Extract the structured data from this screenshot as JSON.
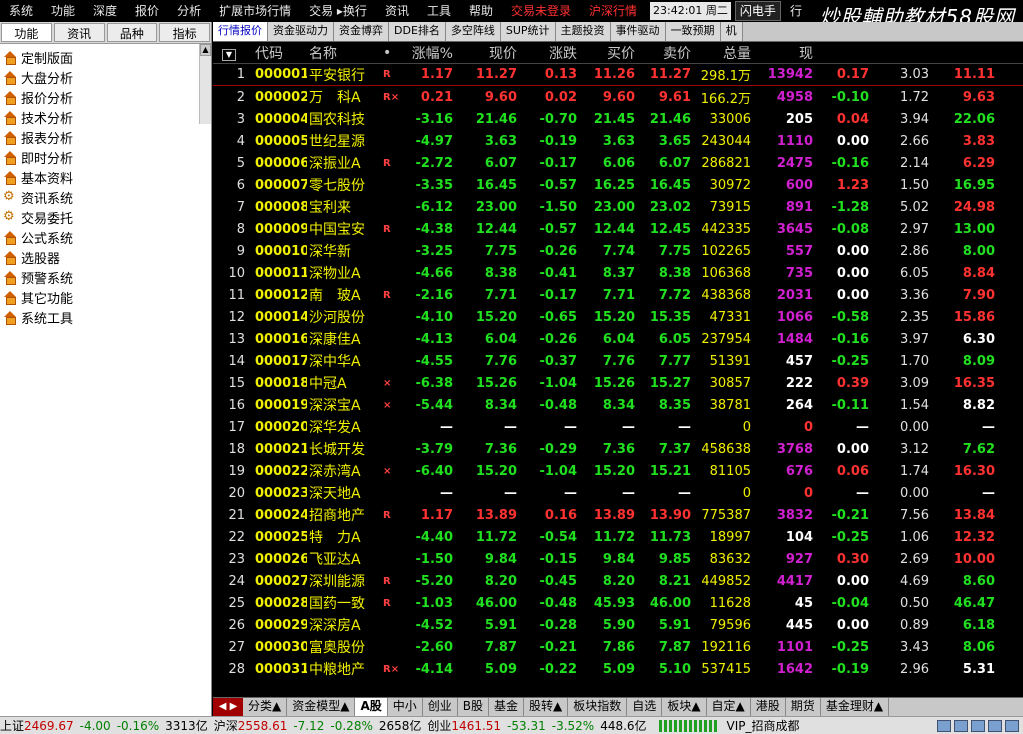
{
  "menubar": {
    "items": [
      "系统",
      "功能",
      "深度",
      "报价",
      "分析",
      "扩展市场行情",
      "交易 ▸换行",
      "资讯",
      "工具",
      "帮助"
    ],
    "red_items": [
      "交易未登录",
      "沪深行情"
    ],
    "time": "23:42:01",
    "weekday": "周二",
    "flash_label": "闪电手",
    "more_label": "行",
    "watermark": "炒股輔助教材58股网",
    "watermark_url": "www.58Gu.com"
  },
  "lefttabs": [
    "功能",
    "资讯",
    "品种",
    "指标"
  ],
  "nav": [
    {
      "label": "定制版面",
      "icon": "house-icon"
    },
    {
      "label": "大盘分析",
      "icon": "house-icon"
    },
    {
      "label": "报价分析",
      "icon": "house-icon"
    },
    {
      "label": "技术分析",
      "icon": "house-icon"
    },
    {
      "label": "报表分析",
      "icon": "house-icon"
    },
    {
      "label": "即时分析",
      "icon": "house-icon"
    },
    {
      "label": "基本资料",
      "icon": "house-icon"
    },
    {
      "label": "资讯系统",
      "icon": "gears-icon"
    },
    {
      "label": "交易委托",
      "icon": "gears-icon"
    },
    {
      "label": "公式系统",
      "icon": "house-icon"
    },
    {
      "label": "选股器",
      "icon": "house-icon"
    },
    {
      "label": "预警系统",
      "icon": "house-icon"
    },
    {
      "label": "其它功能",
      "icon": "house-icon"
    },
    {
      "label": "系统工具",
      "icon": "house-icon"
    }
  ],
  "toptabs": [
    "行情报价",
    "资金驱动力",
    "资金博弈",
    "DDE排名",
    "多空阵线",
    "SUP统计",
    "主题投资",
    "事件驱动",
    "一致预期",
    "机"
  ],
  "columns": [
    "代码",
    "名称",
    "•",
    "涨幅%",
    "现价",
    "涨跌",
    "买价",
    "卖价",
    "总量",
    "现",
    "",
    "",
    ""
  ],
  "rows": [
    {
      "idx": "1",
      "code": "000001",
      "name": "平安银行",
      "flag": "R",
      "chg": "1.17",
      "price": "11.27",
      "delta": "0.13",
      "buy": "11.26",
      "sell": "11.27",
      "vol": "298.1万",
      "now": "13942",
      "spd": "0.17",
      "turn": "3.03",
      "pe": "11.11",
      "dir": "up",
      "spd_dir": "up",
      "pe_dir": "up"
    },
    {
      "idx": "2",
      "code": "000002",
      "name": "万　科A",
      "flag": "R×",
      "chg": "0.21",
      "price": "9.60",
      "delta": "0.02",
      "buy": "9.60",
      "sell": "9.61",
      "vol": "166.2万",
      "now": "4958",
      "spd": "-0.10",
      "turn": "1.72",
      "pe": "9.63",
      "dir": "up",
      "spd_dir": "dn",
      "pe_dir": "up"
    },
    {
      "idx": "3",
      "code": "000004",
      "name": "国农科技",
      "flag": "",
      "chg": "-3.16",
      "price": "21.46",
      "delta": "-0.70",
      "buy": "21.45",
      "sell": "21.46",
      "vol": "33006",
      "now": "205",
      "spd": "0.04",
      "turn": "3.94",
      "pe": "22.06",
      "dir": "dn",
      "spd_dir": "up",
      "pe_dir": "dn",
      "now_white": true
    },
    {
      "idx": "4",
      "code": "000005",
      "name": "世纪星源",
      "flag": "",
      "chg": "-4.97",
      "price": "3.63",
      "delta": "-0.19",
      "buy": "3.63",
      "sell": "3.65",
      "vol": "243044",
      "now": "1110",
      "spd": "0.00",
      "turn": "2.66",
      "pe": "3.83",
      "dir": "dn",
      "spd_dir": "eq",
      "pe_dir": "up"
    },
    {
      "idx": "5",
      "code": "000006",
      "name": "深振业A",
      "flag": "R",
      "chg": "-2.72",
      "price": "6.07",
      "delta": "-0.17",
      "buy": "6.06",
      "sell": "6.07",
      "vol": "286821",
      "now": "2475",
      "spd": "-0.16",
      "turn": "2.14",
      "pe": "6.29",
      "dir": "dn",
      "spd_dir": "dn",
      "pe_dir": "up"
    },
    {
      "idx": "6",
      "code": "000007",
      "name": "零七股份",
      "flag": "",
      "chg": "-3.35",
      "price": "16.45",
      "delta": "-0.57",
      "buy": "16.25",
      "sell": "16.45",
      "vol": "30972",
      "now": "600",
      "spd": "1.23",
      "turn": "1.50",
      "pe": "16.95",
      "dir": "dn",
      "spd_dir": "up",
      "pe_dir": "dn"
    },
    {
      "idx": "7",
      "code": "000008",
      "name": "宝利来",
      "flag": "",
      "chg": "-6.12",
      "price": "23.00",
      "delta": "-1.50",
      "buy": "23.00",
      "sell": "23.02",
      "vol": "73915",
      "now": "891",
      "spd": "-1.28",
      "turn": "5.02",
      "pe": "24.98",
      "dir": "dn",
      "spd_dir": "dn",
      "pe_dir": "up"
    },
    {
      "idx": "8",
      "code": "000009",
      "name": "中国宝安",
      "flag": "R",
      "chg": "-4.38",
      "price": "12.44",
      "delta": "-0.57",
      "buy": "12.44",
      "sell": "12.45",
      "vol": "442335",
      "now": "3645",
      "spd": "-0.08",
      "turn": "2.97",
      "pe": "13.00",
      "dir": "dn",
      "spd_dir": "dn",
      "pe_dir": "dn"
    },
    {
      "idx": "9",
      "code": "000010",
      "name": "深华新",
      "flag": "",
      "chg": "-3.25",
      "price": "7.75",
      "delta": "-0.26",
      "buy": "7.74",
      "sell": "7.75",
      "vol": "102265",
      "now": "557",
      "spd": "0.00",
      "turn": "2.86",
      "pe": "8.00",
      "dir": "dn",
      "spd_dir": "eq",
      "pe_dir": "dn"
    },
    {
      "idx": "10",
      "code": "000011",
      "name": "深物业A",
      "flag": "",
      "chg": "-4.66",
      "price": "8.38",
      "delta": "-0.41",
      "buy": "8.37",
      "sell": "8.38",
      "vol": "106368",
      "now": "735",
      "spd": "0.00",
      "turn": "6.05",
      "pe": "8.84",
      "dir": "dn",
      "spd_dir": "eq",
      "pe_dir": "up"
    },
    {
      "idx": "11",
      "code": "000012",
      "name": "南　玻A",
      "flag": "R",
      "chg": "-2.16",
      "price": "7.71",
      "delta": "-0.17",
      "buy": "7.71",
      "sell": "7.72",
      "vol": "438368",
      "now": "2031",
      "spd": "0.00",
      "turn": "3.36",
      "pe": "7.90",
      "dir": "dn",
      "spd_dir": "eq",
      "pe_dir": "up"
    },
    {
      "idx": "12",
      "code": "000014",
      "name": "沙河股份",
      "flag": "",
      "chg": "-4.10",
      "price": "15.20",
      "delta": "-0.65",
      "buy": "15.20",
      "sell": "15.35",
      "vol": "47331",
      "now": "1066",
      "spd": "-0.58",
      "turn": "2.35",
      "pe": "15.86",
      "dir": "dn",
      "spd_dir": "dn",
      "pe_dir": "up"
    },
    {
      "idx": "13",
      "code": "000016",
      "name": "深康佳A",
      "flag": "",
      "chg": "-4.13",
      "price": "6.04",
      "delta": "-0.26",
      "buy": "6.04",
      "sell": "6.05",
      "vol": "237954",
      "now": "1484",
      "spd": "-0.16",
      "turn": "3.97",
      "pe": "6.30",
      "dir": "dn",
      "spd_dir": "dn",
      "pe_dir": "eq"
    },
    {
      "idx": "14",
      "code": "000017",
      "name": "深中华A",
      "flag": "",
      "chg": "-4.55",
      "price": "7.76",
      "delta": "-0.37",
      "buy": "7.76",
      "sell": "7.77",
      "vol": "51391",
      "now": "457",
      "spd": "-0.25",
      "turn": "1.70",
      "pe": "8.09",
      "dir": "dn",
      "spd_dir": "dn",
      "pe_dir": "dn",
      "now_white": true
    },
    {
      "idx": "15",
      "code": "000018",
      "name": "中冠A",
      "flag": "×",
      "chg": "-6.38",
      "price": "15.26",
      "delta": "-1.04",
      "buy": "15.26",
      "sell": "15.27",
      "vol": "30857",
      "now": "222",
      "spd": "0.39",
      "turn": "3.09",
      "pe": "16.35",
      "dir": "dn",
      "spd_dir": "up",
      "pe_dir": "up",
      "now_white": true
    },
    {
      "idx": "16",
      "code": "000019",
      "name": "深深宝A",
      "flag": "×",
      "chg": "-5.44",
      "price": "8.34",
      "delta": "-0.48",
      "buy": "8.34",
      "sell": "8.35",
      "vol": "38781",
      "now": "264",
      "spd": "-0.11",
      "turn": "1.54",
      "pe": "8.82",
      "dir": "dn",
      "spd_dir": "dn",
      "pe_dir": "eq",
      "now_white": true
    },
    {
      "idx": "17",
      "code": "000020",
      "name": "深华发A",
      "flag": "",
      "chg": "—",
      "price": "—",
      "delta": "—",
      "buy": "—",
      "sell": "—",
      "vol": "0",
      "now": "0",
      "spd": "—",
      "turn": "0.00",
      "pe": "—",
      "dir": "eq",
      "spd_dir": "eq",
      "pe_dir": "eq",
      "now_red": true
    },
    {
      "idx": "18",
      "code": "000021",
      "name": "长城开发",
      "flag": "",
      "chg": "-3.79",
      "price": "7.36",
      "delta": "-0.29",
      "buy": "7.36",
      "sell": "7.37",
      "vol": "458638",
      "now": "3768",
      "spd": "0.00",
      "turn": "3.12",
      "pe": "7.62",
      "dir": "dn",
      "spd_dir": "eq",
      "pe_dir": "dn"
    },
    {
      "idx": "19",
      "code": "000022",
      "name": "深赤湾A",
      "flag": "×",
      "chg": "-6.40",
      "price": "15.20",
      "delta": "-1.04",
      "buy": "15.20",
      "sell": "15.21",
      "vol": "81105",
      "now": "676",
      "spd": "0.06",
      "turn": "1.74",
      "pe": "16.30",
      "dir": "dn",
      "spd_dir": "up",
      "pe_dir": "up"
    },
    {
      "idx": "20",
      "code": "000023",
      "name": "深天地A",
      "flag": "",
      "chg": "—",
      "price": "—",
      "delta": "—",
      "buy": "—",
      "sell": "—",
      "vol": "0",
      "now": "0",
      "spd": "—",
      "turn": "0.00",
      "pe": "—",
      "dir": "eq",
      "spd_dir": "eq",
      "pe_dir": "eq",
      "now_red": true
    },
    {
      "idx": "21",
      "code": "000024",
      "name": "招商地产",
      "flag": "R",
      "chg": "1.17",
      "price": "13.89",
      "delta": "0.16",
      "buy": "13.89",
      "sell": "13.90",
      "vol": "775387",
      "now": "3832",
      "spd": "-0.21",
      "turn": "7.56",
      "pe": "13.84",
      "dir": "up",
      "spd_dir": "dn",
      "pe_dir": "up"
    },
    {
      "idx": "22",
      "code": "000025",
      "name": "特　力A",
      "flag": "",
      "chg": "-4.40",
      "price": "11.72",
      "delta": "-0.54",
      "buy": "11.72",
      "sell": "11.73",
      "vol": "18997",
      "now": "104",
      "spd": "-0.25",
      "turn": "1.06",
      "pe": "12.32",
      "dir": "dn",
      "spd_dir": "dn",
      "pe_dir": "up",
      "now_white": true
    },
    {
      "idx": "23",
      "code": "000026",
      "name": "飞亚达A",
      "flag": "",
      "chg": "-1.50",
      "price": "9.84",
      "delta": "-0.15",
      "buy": "9.84",
      "sell": "9.85",
      "vol": "83632",
      "now": "927",
      "spd": "0.30",
      "turn": "2.69",
      "pe": "10.00",
      "dir": "dn",
      "spd_dir": "up",
      "pe_dir": "up"
    },
    {
      "idx": "24",
      "code": "000027",
      "name": "深圳能源",
      "flag": "R",
      "chg": "-5.20",
      "price": "8.20",
      "delta": "-0.45",
      "buy": "8.20",
      "sell": "8.21",
      "vol": "449852",
      "now": "4417",
      "spd": "0.00",
      "turn": "4.69",
      "pe": "8.60",
      "dir": "dn",
      "spd_dir": "eq",
      "pe_dir": "dn"
    },
    {
      "idx": "25",
      "code": "000028",
      "name": "国药一致",
      "flag": "R",
      "chg": "-1.03",
      "price": "46.00",
      "delta": "-0.48",
      "buy": "45.93",
      "sell": "46.00",
      "vol": "11628",
      "now": "45",
      "spd": "-0.04",
      "turn": "0.50",
      "pe": "46.47",
      "dir": "dn",
      "spd_dir": "dn",
      "pe_dir": "dn",
      "now_white": true
    },
    {
      "idx": "26",
      "code": "000029",
      "name": "深深房A",
      "flag": "",
      "chg": "-4.52",
      "price": "5.91",
      "delta": "-0.28",
      "buy": "5.90",
      "sell": "5.91",
      "vol": "79596",
      "now": "445",
      "spd": "0.00",
      "turn": "0.89",
      "pe": "6.18",
      "dir": "dn",
      "spd_dir": "eq",
      "pe_dir": "dn",
      "now_white": true
    },
    {
      "idx": "27",
      "code": "000030",
      "name": "富奥股份",
      "flag": "",
      "chg": "-2.60",
      "price": "7.87",
      "delta": "-0.21",
      "buy": "7.86",
      "sell": "7.87",
      "vol": "192116",
      "now": "1101",
      "spd": "-0.25",
      "turn": "3.43",
      "pe": "8.06",
      "dir": "dn",
      "spd_dir": "dn",
      "pe_dir": "dn"
    },
    {
      "idx": "28",
      "code": "000031",
      "name": "中粮地产",
      "flag": "R×",
      "chg": "-4.14",
      "price": "5.09",
      "delta": "-0.22",
      "buy": "5.09",
      "sell": "5.10",
      "vol": "537415",
      "now": "1642",
      "spd": "-0.19",
      "turn": "2.96",
      "pe": "5.31",
      "dir": "dn",
      "spd_dir": "dn",
      "pe_dir": "eq"
    }
  ],
  "bottomtabs": [
    "分类▲",
    "资金模型▲",
    "A股",
    "中小",
    "创业",
    "B股",
    "基金",
    "股转▲",
    "板块指数",
    "自选",
    "板块▲",
    "自定▲",
    "港股",
    "期货",
    "基金理财▲"
  ],
  "status": {
    "sh_label": "上证",
    "sh_value": "2469.67",
    "sh_chg": "-4.00",
    "sh_pct": "-0.16%",
    "sh_amt": "3313亿",
    "hs_label": "沪深",
    "hs_value": "2558.61",
    "hs_chg": "-7.12",
    "hs_pct": "-0.28%",
    "hs_amt": "2658亿",
    "cy_label": "创业",
    "cy_value": "1461.51",
    "cy_chg": "-53.31",
    "cy_pct": "-3.52%",
    "cy_amt": "448.6亿",
    "vip": "VIP_招商成都"
  }
}
